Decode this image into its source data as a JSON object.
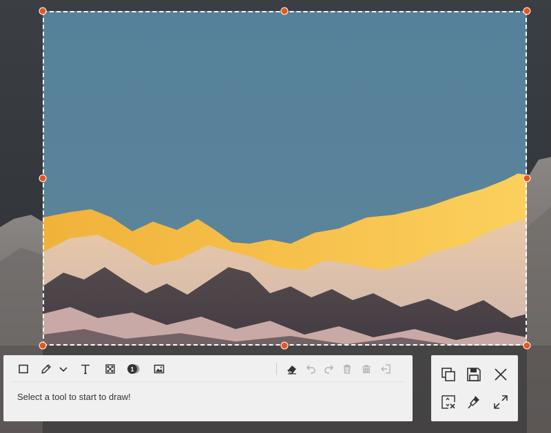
{
  "colors": {
    "accent": "#e2571e",
    "toolbar_bg": "#f0f0f0",
    "icon_dark": "#333333",
    "icon_disabled": "#b5b5b5"
  },
  "toolbar": {
    "tools": [
      {
        "name": "rectangle-icon"
      },
      {
        "name": "pen-icon"
      },
      {
        "name": "chevron-down-icon"
      },
      {
        "name": "text-icon"
      },
      {
        "name": "mosaic-icon"
      },
      {
        "name": "step-number-icon",
        "label": "1"
      },
      {
        "name": "image-icon"
      },
      {
        "name": "eraser-icon"
      },
      {
        "name": "undo-icon",
        "state": "disabled"
      },
      {
        "name": "redo-icon",
        "state": "disabled"
      },
      {
        "name": "delete-icon",
        "state": "disabled"
      },
      {
        "name": "clear-all-icon",
        "state": "disabled"
      },
      {
        "name": "exit-icon",
        "state": "disabled"
      }
    ],
    "hint": "Select a tool to start to draw!"
  },
  "actions": [
    {
      "name": "copy-icon"
    },
    {
      "name": "save-icon"
    },
    {
      "name": "close-icon"
    },
    {
      "name": "resize-icon"
    },
    {
      "name": "pin-icon"
    },
    {
      "name": "fullscreen-icon"
    }
  ]
}
